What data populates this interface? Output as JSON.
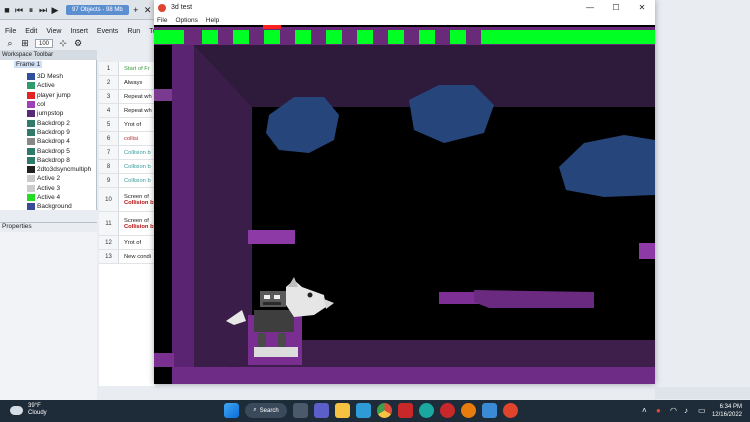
{
  "editor": {
    "doc_tab": "97 Objects - 98 Mb",
    "menu": [
      "File",
      "Edit",
      "View",
      "Insert",
      "Events",
      "Run",
      "Tools"
    ],
    "zoom": "100",
    "workspace_title": "Workspace Toolbar",
    "tree_root": "Frame 1",
    "tree_items": [
      {
        "label": "3D Mesh",
        "color": "#2f4f9a"
      },
      {
        "label": "Active",
        "color": "#2f9a6a"
      },
      {
        "label": "player jump",
        "color": "#e12323"
      },
      {
        "label": "col",
        "color": "#a040b8"
      },
      {
        "label": "jumpstop",
        "color": "#5a2a7a"
      },
      {
        "label": "Backdrop 2",
        "color": "#2f7a6a"
      },
      {
        "label": "Backdrop 9",
        "color": "#2f7a6a"
      },
      {
        "label": "Backdrop 4",
        "color": "#888888"
      },
      {
        "label": "Backdrop 5",
        "color": "#2f7a6a"
      },
      {
        "label": "Backdrop 8",
        "color": "#2f7a6a"
      },
      {
        "label": "2dto3dsyncmultiph",
        "color": "#222222"
      },
      {
        "label": "Active 2",
        "color": "#cccccc"
      },
      {
        "label": "Active 3",
        "color": "#cccccc"
      },
      {
        "label": "Active 4",
        "color": "#22dd22"
      },
      {
        "label": "Background",
        "color": "#3a4a9a"
      }
    ],
    "properties_title": "Properties",
    "events": [
      {
        "num": "1",
        "text": "Start of Fr",
        "color": "#3a9a3a"
      },
      {
        "num": "2",
        "text": "Always",
        "color": "#222222"
      },
      {
        "num": "3",
        "text": "Repeat wh",
        "color": "#222222"
      },
      {
        "num": "4",
        "text": "Repeat wh",
        "color": "#222222"
      },
      {
        "num": "5",
        "text": "Yrot of",
        "color": "#222222"
      },
      {
        "num": "6",
        "text": "collisi",
        "color": "#b03030"
      },
      {
        "num": "7",
        "text": "Collision b",
        "color": "#3a9a9a"
      },
      {
        "num": "8",
        "text": "Collision b",
        "color": "#3a9a9a"
      },
      {
        "num": "9",
        "text": "Collision b",
        "color": "#3a9a9a"
      },
      {
        "num": "10",
        "text": "Screen of",
        "color": "#222222",
        "sub": "Collision b"
      },
      {
        "num": "11",
        "text": "Screen of",
        "color": "#222222",
        "sub": "Collision b"
      },
      {
        "num": "12",
        "text": "Yrot of",
        "color": "#222222"
      },
      {
        "num": "13",
        "text": "New condi",
        "color": "#222222"
      }
    ]
  },
  "game": {
    "title": "3d test",
    "menu": [
      "File",
      "Options",
      "Help"
    ]
  },
  "taskbar": {
    "temp": "39°F",
    "condition": "Cloudy",
    "search": "Search",
    "time": "6:34 PM",
    "date": "12/16/2022"
  }
}
